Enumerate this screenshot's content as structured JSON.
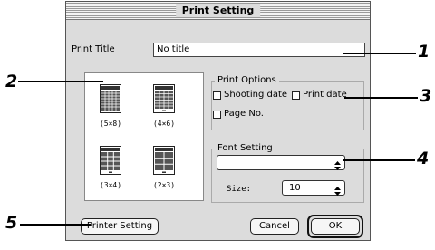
{
  "dialog": {
    "title": "Print Setting"
  },
  "print_title": {
    "label": "Print Title",
    "value": "No title"
  },
  "layouts": [
    {
      "label": "(5×8)"
    },
    {
      "label": "(4×6)"
    },
    {
      "label": "(3×4)"
    },
    {
      "label": "(2×3)"
    }
  ],
  "print_options": {
    "title": "Print Options",
    "shooting_date": {
      "label": "Shooting date",
      "checked": false
    },
    "print_date": {
      "label": "Print date",
      "checked": false
    },
    "page_no": {
      "label": "Page No.",
      "checked": false
    }
  },
  "font_setting": {
    "title": "Font Setting",
    "font_value": "",
    "size_label": "Size:",
    "size_value": "10"
  },
  "buttons": {
    "printer_setting": "Printer Setting",
    "cancel": "Cancel",
    "ok": "OK"
  },
  "callouts": {
    "c1": "1",
    "c2": "2",
    "c3": "3",
    "c4": "4",
    "c5": "5"
  },
  "icons": [
    "updown-arrows-icon",
    "layout-thumbnail-icon",
    "checkbox-icon"
  ]
}
